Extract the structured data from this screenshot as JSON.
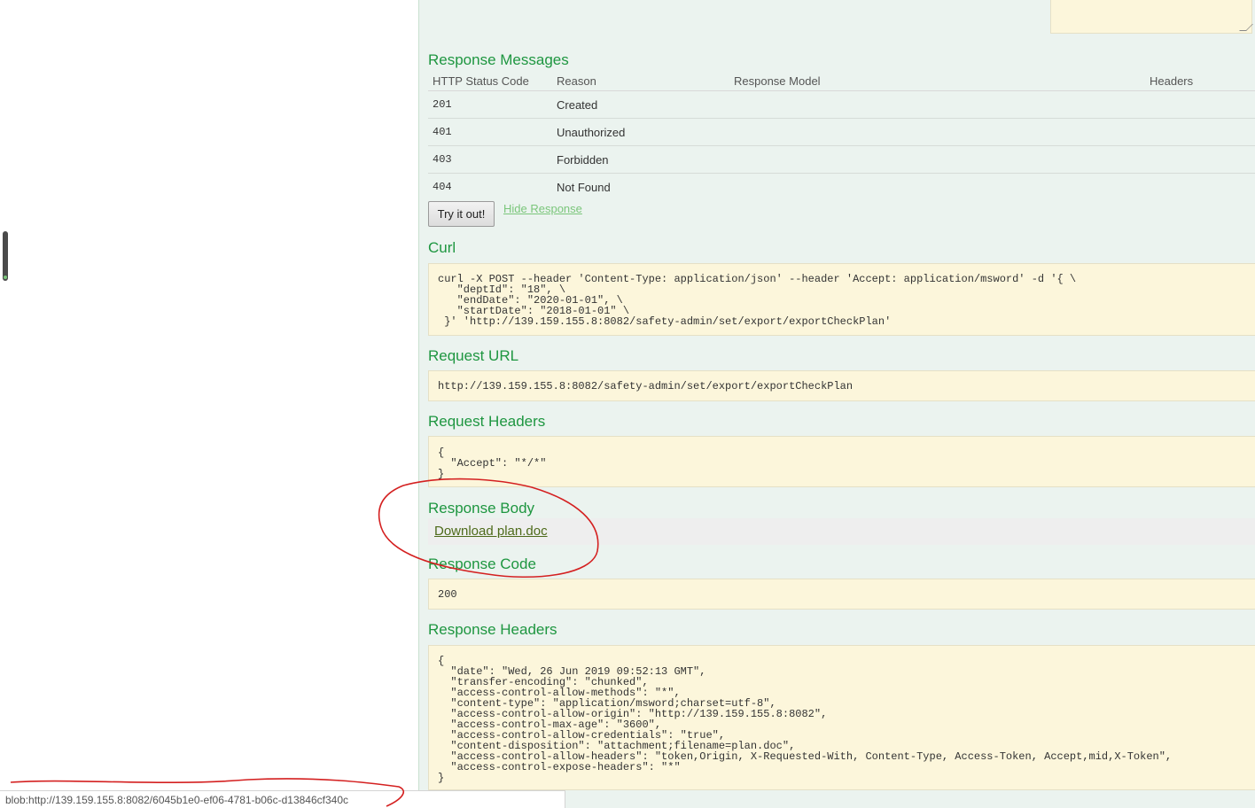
{
  "response_messages": {
    "title": "Response Messages",
    "headers": [
      "HTTP Status Code",
      "Reason",
      "Response Model",
      "Headers"
    ],
    "rows": [
      {
        "code": "201",
        "reason": "Created"
      },
      {
        "code": "401",
        "reason": "Unauthorized"
      },
      {
        "code": "403",
        "reason": "Forbidden"
      },
      {
        "code": "404",
        "reason": "Not Found"
      }
    ]
  },
  "actions": {
    "try_label": "Try it out!",
    "hide_response_label": "Hide Response"
  },
  "curl": {
    "title": "Curl",
    "text": "curl -X POST --header 'Content-Type: application/json' --header 'Accept: application/msword' -d '{ \\\n   \"deptId\": \"18\", \\\n   \"endDate\": \"2020-01-01\", \\\n   \"startDate\": \"2018-01-01\" \\\n }' 'http://139.159.155.8:8082/safety-admin/set/export/exportCheckPlan'"
  },
  "request_url": {
    "title": "Request URL",
    "text": "http://139.159.155.8:8082/safety-admin/set/export/exportCheckPlan"
  },
  "request_headers": {
    "title": "Request Headers",
    "text": "{\n  \"Accept\": \"*/*\"\n}"
  },
  "response_body": {
    "title": "Response Body",
    "download_label": "Download plan.doc"
  },
  "response_code": {
    "title": "Response Code",
    "text": "200"
  },
  "response_headers": {
    "title": "Response Headers",
    "text": "{\n  \"date\": \"Wed, 26 Jun 2019 09:52:13 GMT\",\n  \"transfer-encoding\": \"chunked\",\n  \"access-control-allow-methods\": \"*\",\n  \"content-type\": \"application/msword;charset=utf-8\",\n  \"access-control-allow-origin\": \"http://139.159.155.8:8082\",\n  \"access-control-max-age\": \"3600\",\n  \"access-control-allow-credentials\": \"true\",\n  \"content-disposition\": \"attachment;filename=plan.doc\",\n  \"access-control-allow-headers\": \"token,Origin, X-Requested-With, Content-Type, Access-Token, Accept,mid,X-Token\",\n  \"access-control-expose-headers\": \"*\"\n}"
  },
  "status_bar": {
    "url": "blob:http://139.159.155.8:8082/6045b1e0-ef06-4781-b06c-d13846cf340c"
  },
  "colors": {
    "section_title": "#1e9640",
    "panel_bg": "#ebf3ef",
    "code_bg": "#fcf6db",
    "annotation": "#d42020"
  }
}
